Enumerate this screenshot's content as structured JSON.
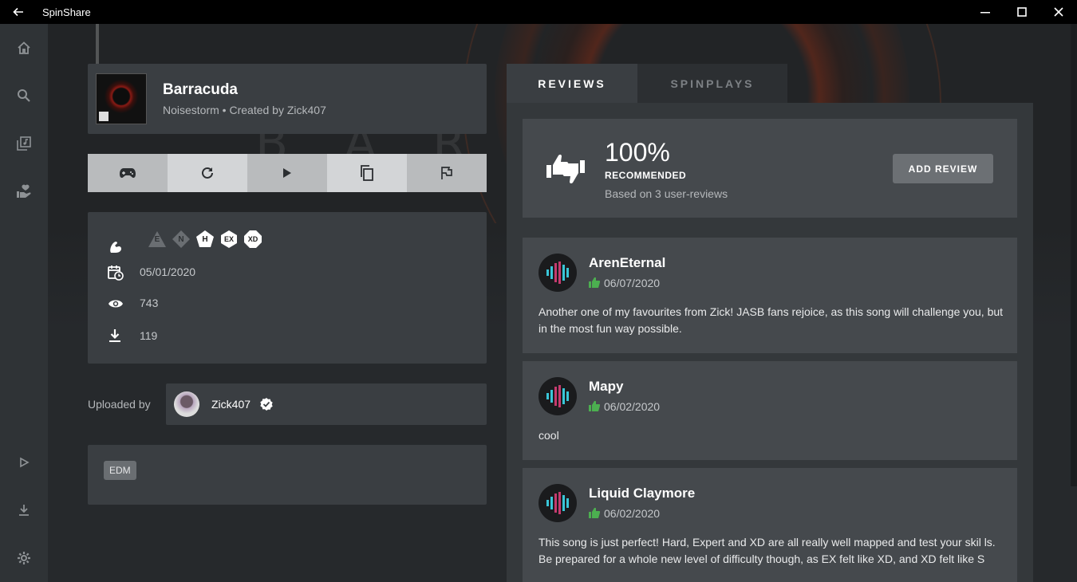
{
  "window": {
    "title": "SpinShare"
  },
  "song": {
    "title": "Barracuda",
    "subtitle": "Noisestorm • Created by Zick407"
  },
  "meta": {
    "difficulties": [
      "E",
      "N",
      "H",
      "EX",
      "XD"
    ],
    "difficulties_available": [
      false,
      false,
      true,
      true,
      true
    ],
    "upload_date": "05/01/2020",
    "views": "743",
    "downloads": "119"
  },
  "uploader": {
    "label": "Uploaded by",
    "name": "Zick407"
  },
  "tags": [
    "EDM"
  ],
  "tabs": {
    "reviews": "REVIEWS",
    "spinplays": "SPINPLAYS"
  },
  "summary": {
    "percent": "100%",
    "label": "RECOMMENDED",
    "basis": "Based on 3 user-reviews",
    "add_review": "ADD REVIEW"
  },
  "reviews": [
    {
      "name": "ArenEternal",
      "date": "06/07/2020",
      "text": "Another one of my favourites from Zick! JASB fans rejoice, as this song will challenge you, but in the most fun way possible."
    },
    {
      "name": "Mapy",
      "date": "06/02/2020",
      "text": "cool"
    },
    {
      "name": "Liquid Claymore",
      "date": "06/02/2020",
      "text_line1": "This song is just perfect! Hard, Expert and XD are all really well mapped and test your skil ls.",
      "text_line2": "Be prepared for a whole new level of difficulty though, as EX felt like XD, and XD felt like S"
    }
  ],
  "colors": {
    "accent_green": "#4caf50",
    "card_bg": "#3a3e42",
    "review_bg": "#45494d"
  },
  "icons": {
    "sidebar": [
      "home-icon",
      "search-icon",
      "library-icon",
      "support-icon",
      "play-icon",
      "download-icon",
      "settings-icon"
    ],
    "actions": [
      "gamepad-icon",
      "refresh-icon",
      "play-icon",
      "copy-icon",
      "flag-icon"
    ]
  }
}
